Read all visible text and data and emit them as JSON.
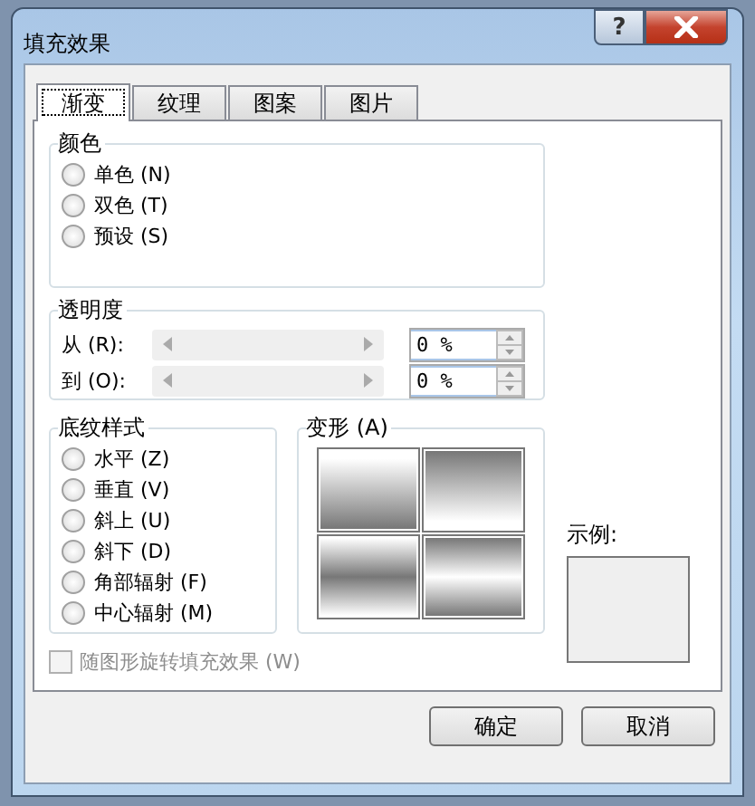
{
  "window": {
    "title": "填充效果",
    "help": "?"
  },
  "tabs": [
    {
      "label": "渐变",
      "selected": true
    },
    {
      "label": "纹理",
      "selected": false
    },
    {
      "label": "图案",
      "selected": false
    },
    {
      "label": "图片",
      "selected": false
    }
  ],
  "color_group": {
    "title": "颜色",
    "options": [
      {
        "label": "单色 (N)",
        "selected": false
      },
      {
        "label": "双色 (T)",
        "selected": false
      },
      {
        "label": "预设 (S)",
        "selected": false
      }
    ]
  },
  "transparency_group": {
    "title": "透明度",
    "rows": [
      {
        "label": "从 (R):",
        "value": "0 %",
        "disabled": true
      },
      {
        "label": "到 (O):",
        "value": "0 %",
        "disabled": true
      }
    ]
  },
  "shading_group": {
    "title": "底纹样式",
    "options": [
      {
        "label": "水平 (Z)",
        "selected": false
      },
      {
        "label": "垂直 (V)",
        "selected": false
      },
      {
        "label": "斜上 (U)",
        "selected": false
      },
      {
        "label": "斜下 (D)",
        "selected": false
      },
      {
        "label": "角部辐射 (F)",
        "selected": false
      },
      {
        "label": "中心辐射 (M)",
        "selected": false
      }
    ]
  },
  "variants_group": {
    "title": "变形 (A)"
  },
  "sample": {
    "label": "示例:"
  },
  "rotate_checkbox": {
    "label": "随图形旋转填充效果 (W)",
    "checked": false,
    "disabled": true
  },
  "buttons": [
    {
      "label": "确定"
    },
    {
      "label": "取消"
    }
  ]
}
